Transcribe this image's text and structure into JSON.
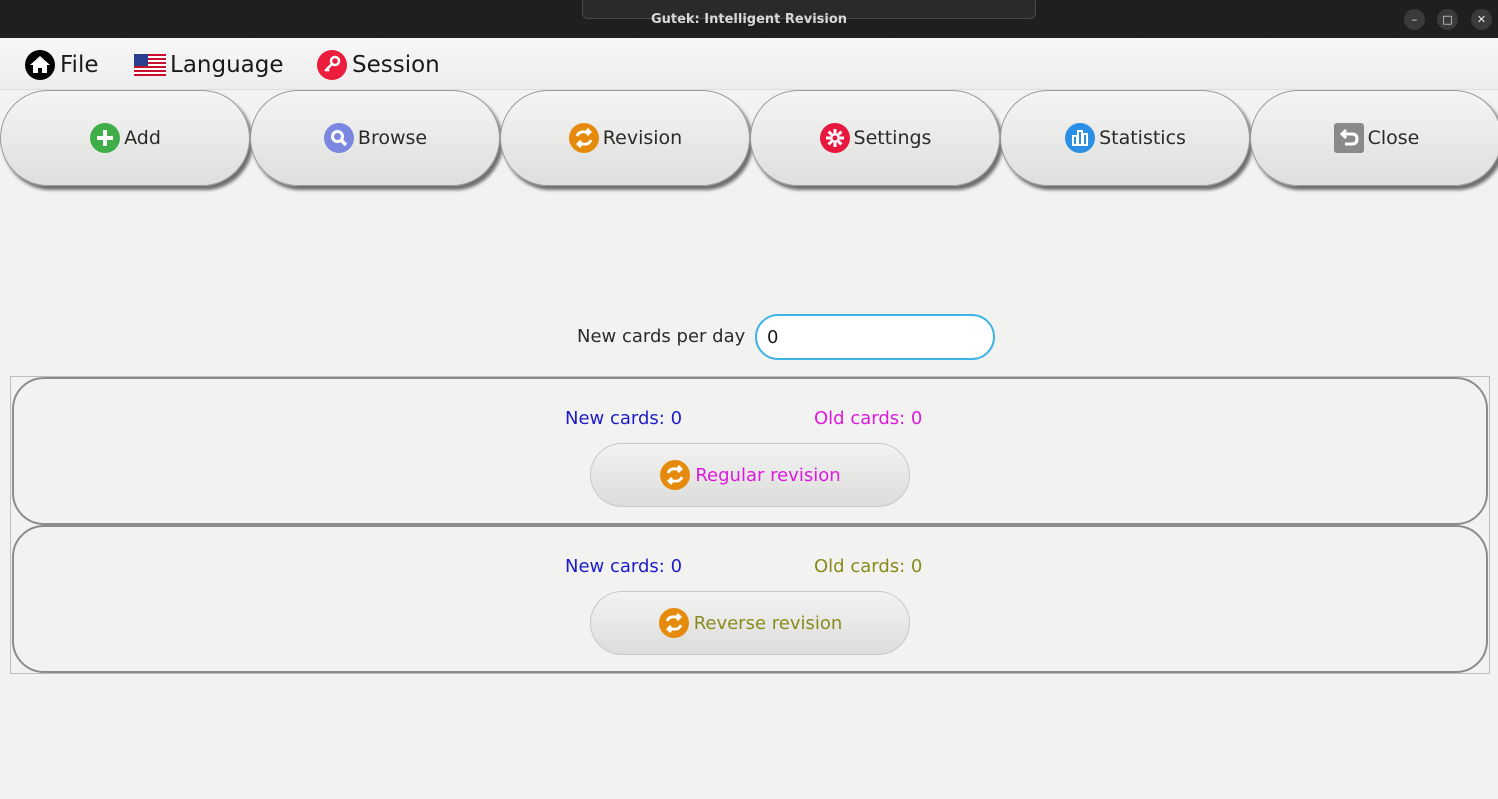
{
  "window": {
    "title": "Gutek: Intelligent Revision",
    "minimize": "–",
    "maximize": "□",
    "close": "✕"
  },
  "menu": {
    "file": "File",
    "language": "Language",
    "session": "Session"
  },
  "toolbar": {
    "add": "Add",
    "browse": "Browse",
    "revision": "Revision",
    "settings": "Settings",
    "statistics": "Statistics",
    "close": "Close"
  },
  "form": {
    "new_per_day_label": "New cards per day",
    "new_per_day_value": "0"
  },
  "regular": {
    "new_cards": "New cards: 0",
    "old_cards": "Old cards: 0",
    "button": "Regular revision"
  },
  "reverse": {
    "new_cards": "New cards: 0",
    "old_cards": "Old cards: 0",
    "button": "Reverse revision"
  },
  "colors": {
    "new_cards": "#1c1ccc",
    "regular_accent": "#dd19dd",
    "reverse_accent": "#8a8a1c",
    "input_border": "#3fb2e6"
  }
}
